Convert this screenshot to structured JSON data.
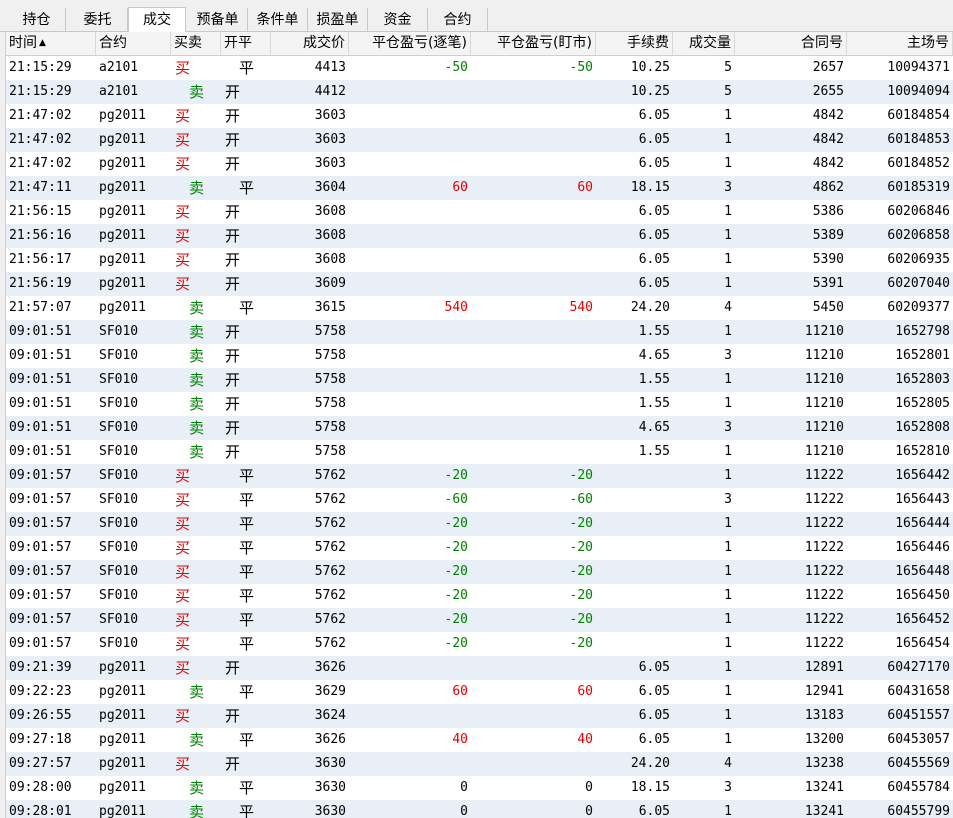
{
  "tabs": [
    {
      "label": "持仓",
      "active": false
    },
    {
      "label": "委托",
      "active": false
    },
    {
      "label": "成交",
      "active": true
    },
    {
      "label": "预备单",
      "active": false
    },
    {
      "label": "条件单",
      "active": false
    },
    {
      "label": "损盈单",
      "active": false
    },
    {
      "label": "资金",
      "active": false
    },
    {
      "label": "合约",
      "active": false
    }
  ],
  "columns": [
    "时间",
    "合约",
    "买卖",
    "开平",
    "成交价",
    "平仓盈亏(逐笔)",
    "平仓盈亏(盯市)",
    "手续费",
    "成交量",
    "合同号",
    "主场号"
  ],
  "sort": {
    "column": "时间",
    "direction": "ascending",
    "icon": "sort-asc-icon",
    "glyph": "▲"
  },
  "colors": {
    "buy": "#e00000",
    "sell": "#008000",
    "profit": "#e00000",
    "loss": "#008000",
    "row_alt": "#e9eff7"
  },
  "rows": [
    [
      "21:15:29",
      "a2101",
      "买",
      "平",
      "4413",
      "-50",
      "-50",
      "10.25",
      "5",
      "2657",
      "10094371"
    ],
    [
      "21:15:29",
      "a2101",
      "卖",
      "开",
      "4412",
      "",
      "",
      "10.25",
      "5",
      "2655",
      "10094094"
    ],
    [
      "21:47:02",
      "pg2011",
      "买",
      "开",
      "3603",
      "",
      "",
      "6.05",
      "1",
      "4842",
      "60184854"
    ],
    [
      "21:47:02",
      "pg2011",
      "买",
      "开",
      "3603",
      "",
      "",
      "6.05",
      "1",
      "4842",
      "60184853"
    ],
    [
      "21:47:02",
      "pg2011",
      "买",
      "开",
      "3603",
      "",
      "",
      "6.05",
      "1",
      "4842",
      "60184852"
    ],
    [
      "21:47:11",
      "pg2011",
      "卖",
      "平",
      "3604",
      "60",
      "60",
      "18.15",
      "3",
      "4862",
      "60185319"
    ],
    [
      "21:56:15",
      "pg2011",
      "买",
      "开",
      "3608",
      "",
      "",
      "6.05",
      "1",
      "5386",
      "60206846"
    ],
    [
      "21:56:16",
      "pg2011",
      "买",
      "开",
      "3608",
      "",
      "",
      "6.05",
      "1",
      "5389",
      "60206858"
    ],
    [
      "21:56:17",
      "pg2011",
      "买",
      "开",
      "3608",
      "",
      "",
      "6.05",
      "1",
      "5390",
      "60206935"
    ],
    [
      "21:56:19",
      "pg2011",
      "买",
      "开",
      "3609",
      "",
      "",
      "6.05",
      "1",
      "5391",
      "60207040"
    ],
    [
      "21:57:07",
      "pg2011",
      "卖",
      "平",
      "3615",
      "540",
      "540",
      "24.20",
      "4",
      "5450",
      "60209377"
    ],
    [
      "09:01:51",
      "SF010",
      "卖",
      "开",
      "5758",
      "",
      "",
      "1.55",
      "1",
      "11210",
      "1652798"
    ],
    [
      "09:01:51",
      "SF010",
      "卖",
      "开",
      "5758",
      "",
      "",
      "4.65",
      "3",
      "11210",
      "1652801"
    ],
    [
      "09:01:51",
      "SF010",
      "卖",
      "开",
      "5758",
      "",
      "",
      "1.55",
      "1",
      "11210",
      "1652803"
    ],
    [
      "09:01:51",
      "SF010",
      "卖",
      "开",
      "5758",
      "",
      "",
      "1.55",
      "1",
      "11210",
      "1652805"
    ],
    [
      "09:01:51",
      "SF010",
      "卖",
      "开",
      "5758",
      "",
      "",
      "4.65",
      "3",
      "11210",
      "1652808"
    ],
    [
      "09:01:51",
      "SF010",
      "卖",
      "开",
      "5758",
      "",
      "",
      "1.55",
      "1",
      "11210",
      "1652810"
    ],
    [
      "09:01:57",
      "SF010",
      "买",
      "平",
      "5762",
      "-20",
      "-20",
      "",
      "1",
      "11222",
      "1656442"
    ],
    [
      "09:01:57",
      "SF010",
      "买",
      "平",
      "5762",
      "-60",
      "-60",
      "",
      "3",
      "11222",
      "1656443"
    ],
    [
      "09:01:57",
      "SF010",
      "买",
      "平",
      "5762",
      "-20",
      "-20",
      "",
      "1",
      "11222",
      "1656444"
    ],
    [
      "09:01:57",
      "SF010",
      "买",
      "平",
      "5762",
      "-20",
      "-20",
      "",
      "1",
      "11222",
      "1656446"
    ],
    [
      "09:01:57",
      "SF010",
      "买",
      "平",
      "5762",
      "-20",
      "-20",
      "",
      "1",
      "11222",
      "1656448"
    ],
    [
      "09:01:57",
      "SF010",
      "买",
      "平",
      "5762",
      "-20",
      "-20",
      "",
      "1",
      "11222",
      "1656450"
    ],
    [
      "09:01:57",
      "SF010",
      "买",
      "平",
      "5762",
      "-20",
      "-20",
      "",
      "1",
      "11222",
      "1656452"
    ],
    [
      "09:01:57",
      "SF010",
      "买",
      "平",
      "5762",
      "-20",
      "-20",
      "",
      "1",
      "11222",
      "1656454"
    ],
    [
      "09:21:39",
      "pg2011",
      "买",
      "开",
      "3626",
      "",
      "",
      "6.05",
      "1",
      "12891",
      "60427170"
    ],
    [
      "09:22:23",
      "pg2011",
      "卖",
      "平",
      "3629",
      "60",
      "60",
      "6.05",
      "1",
      "12941",
      "60431658"
    ],
    [
      "09:26:55",
      "pg2011",
      "买",
      "开",
      "3624",
      "",
      "",
      "6.05",
      "1",
      "13183",
      "60451557"
    ],
    [
      "09:27:18",
      "pg2011",
      "卖",
      "平",
      "3626",
      "40",
      "40",
      "6.05",
      "1",
      "13200",
      "60453057"
    ],
    [
      "09:27:57",
      "pg2011",
      "买",
      "开",
      "3630",
      "",
      "",
      "24.20",
      "4",
      "13238",
      "60455569"
    ],
    [
      "09:28:00",
      "pg2011",
      "卖",
      "平",
      "3630",
      "0",
      "0",
      "18.15",
      "3",
      "13241",
      "60455784"
    ],
    [
      "09:28:01",
      "pg2011",
      "卖",
      "平",
      "3630",
      "0",
      "0",
      "6.05",
      "1",
      "13241",
      "60455799"
    ]
  ]
}
